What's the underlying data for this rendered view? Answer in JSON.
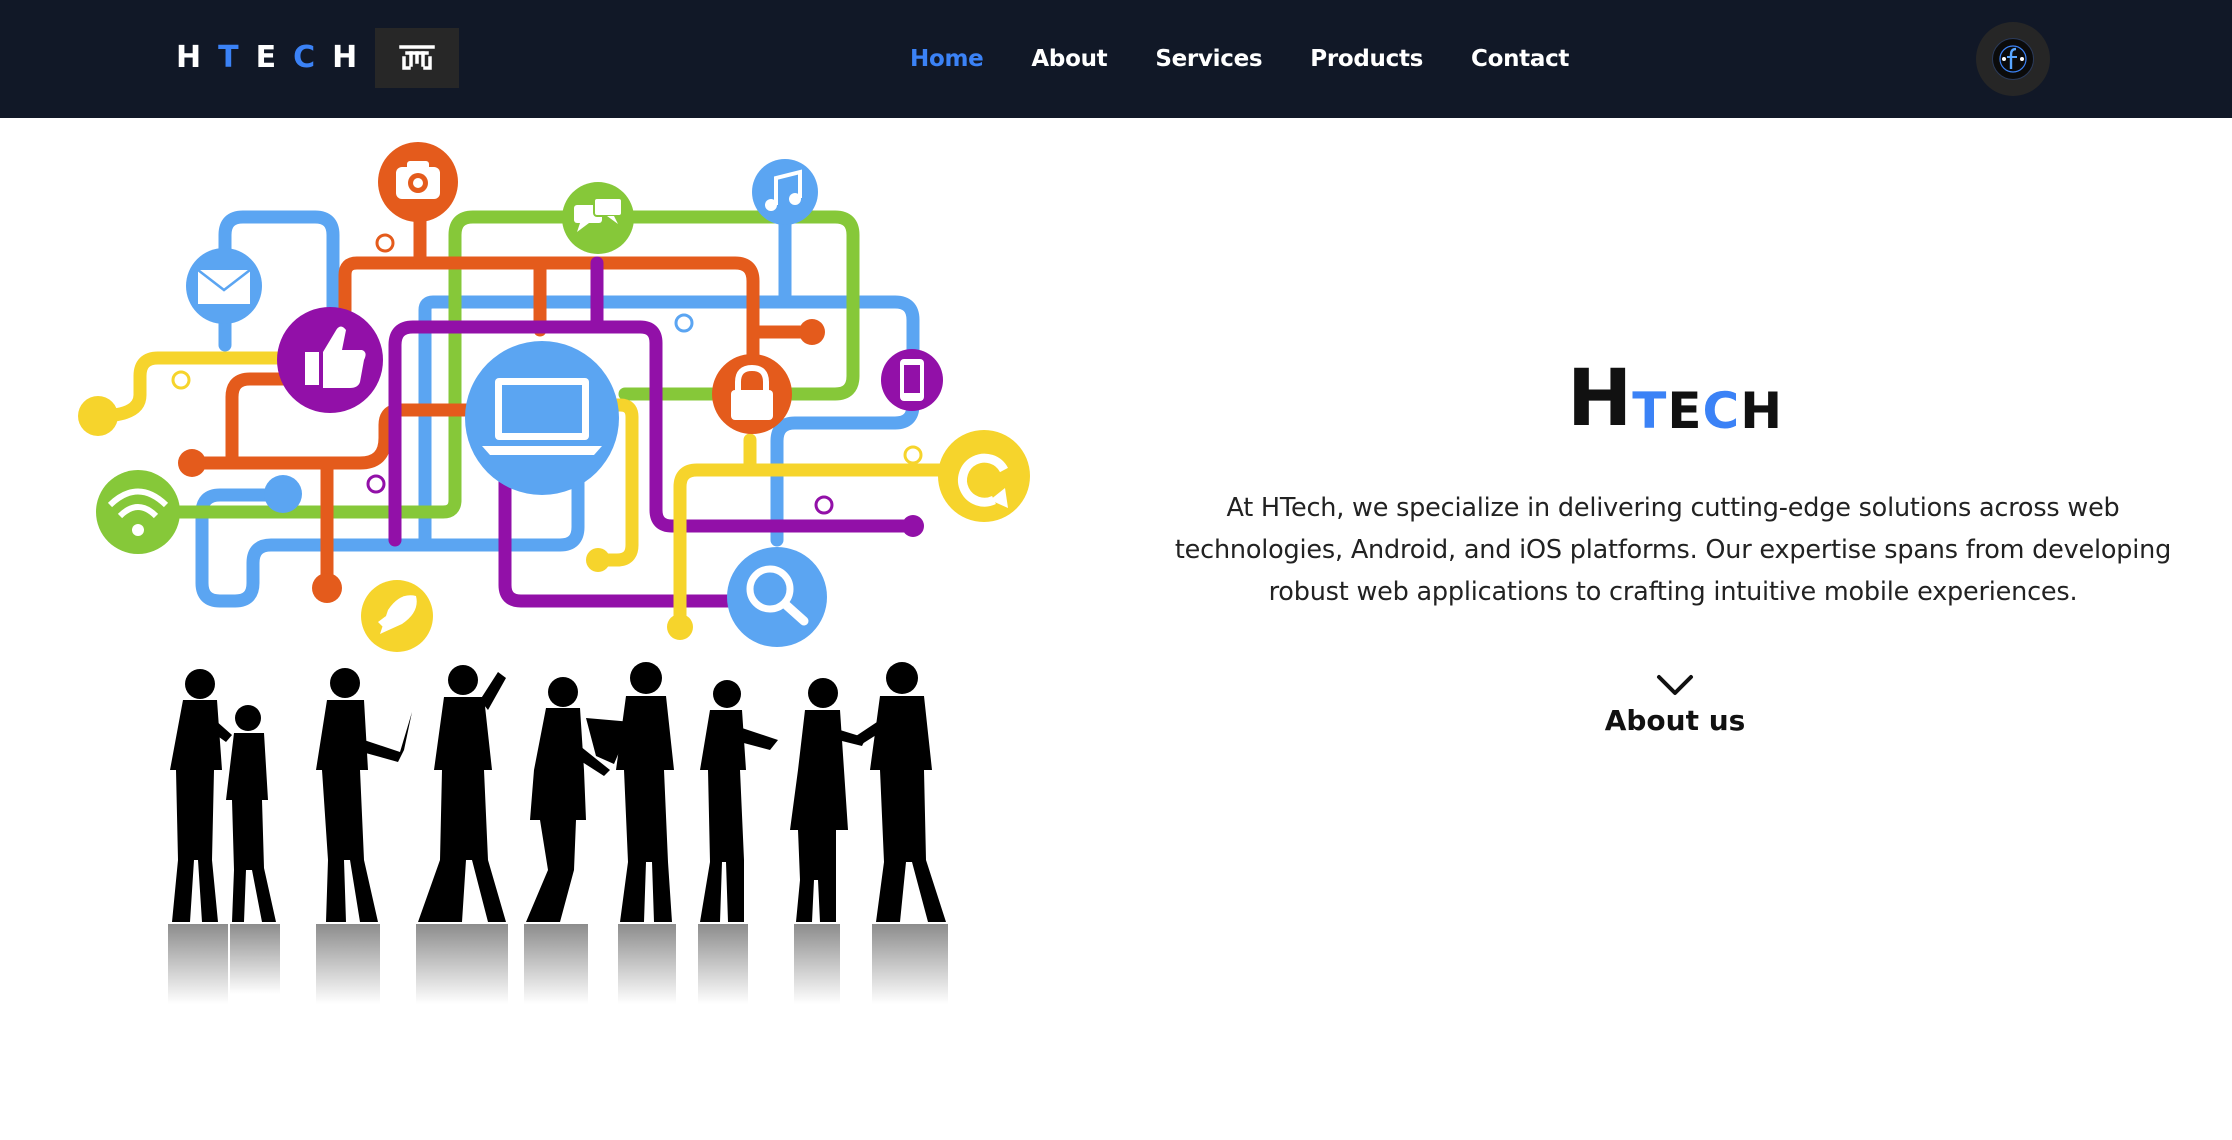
{
  "brand": {
    "letters": [
      "H",
      "T",
      "E",
      "C",
      "H"
    ],
    "accent_color": "#3b82f6",
    "logo_icon": "htech-logo-icon"
  },
  "nav": {
    "items": [
      {
        "label": "Home",
        "active": true
      },
      {
        "label": "About",
        "active": false
      },
      {
        "label": "Services",
        "active": false
      },
      {
        "label": "Products",
        "active": false
      },
      {
        "label": "Contact",
        "active": false
      }
    ],
    "active_color": "#3b82f6",
    "background": "#111827"
  },
  "profile": {
    "icon": "profile-avatar-icon"
  },
  "hero": {
    "title_initial": "H",
    "title_rest": [
      "T",
      "E",
      "C",
      "H"
    ],
    "description": "At HTech, we specialize in delivering cutting-edge solutions across web technologies, Android, and iOS platforms. Our expertise spans from developing robust web applications to crafting intuitive mobile experiences.",
    "scroll_icon": "chevron-down-icon",
    "about_label": "About us",
    "illustration": {
      "icons": [
        "camera-icon",
        "chat-icon",
        "music-icon",
        "mail-icon",
        "thumbs-up-icon",
        "laptop-icon",
        "lock-icon",
        "phone-icon",
        "wifi-icon",
        "rocket-icon",
        "search-icon",
        "refresh-icon"
      ],
      "colors": {
        "blue": "#5ba5f2",
        "orange": "#e45b1c",
        "green": "#86c839",
        "purple": "#9210a8",
        "yellow": "#f6d42c"
      }
    }
  }
}
